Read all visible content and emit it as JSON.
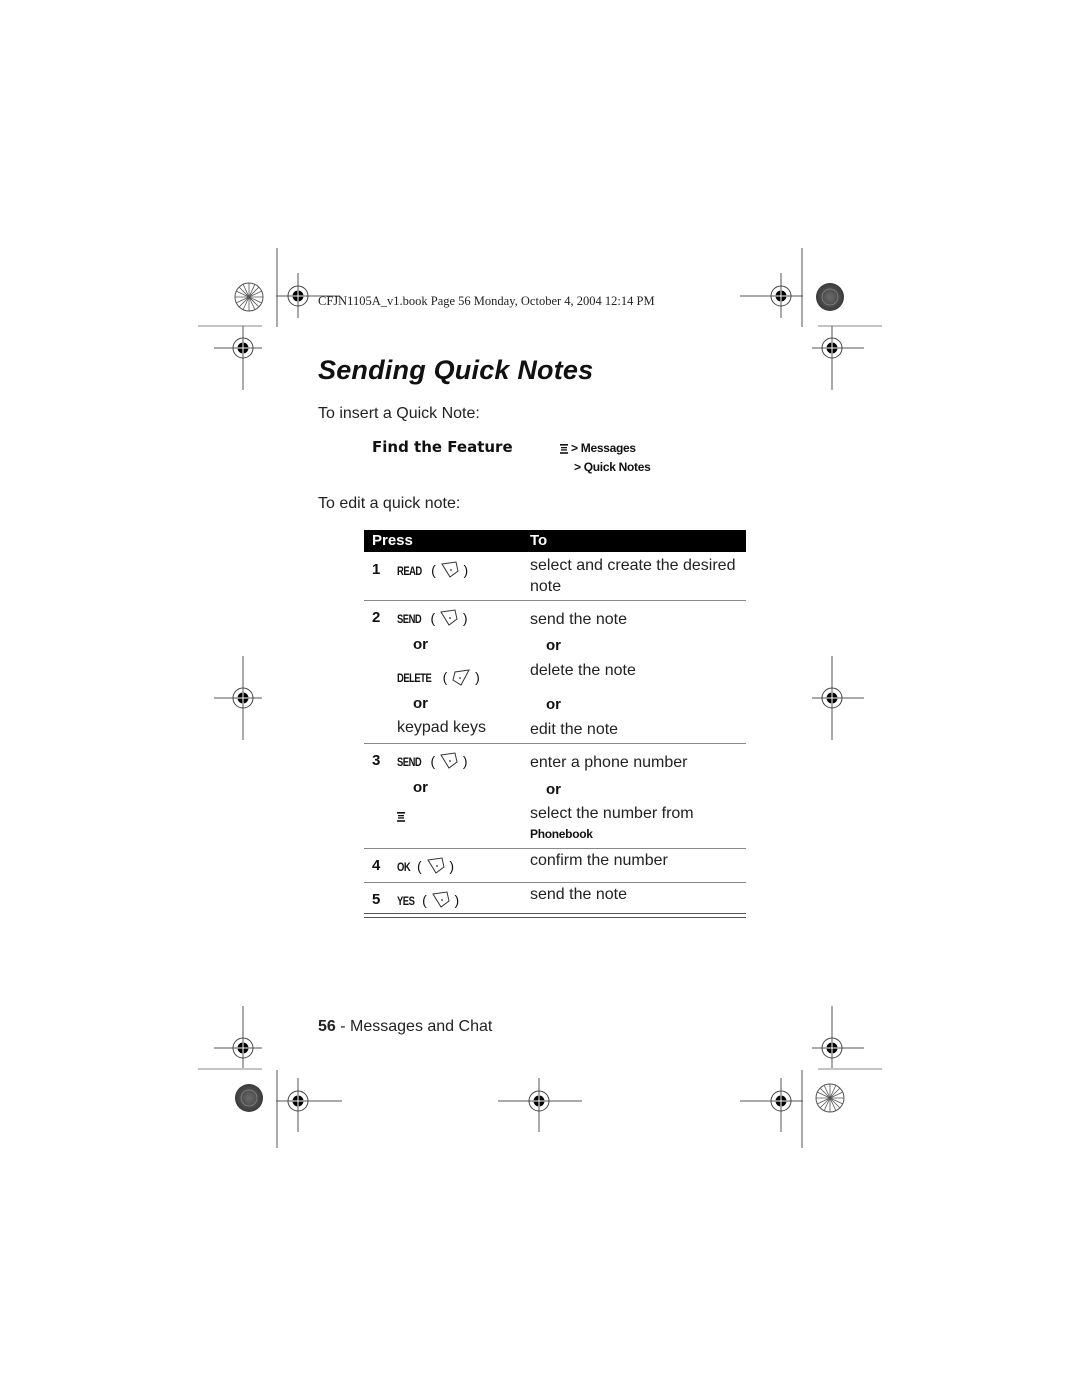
{
  "header": {
    "print_line": "CFJN1105A_v1.book  Page 56  Monday, October 4, 2004  12:14 PM"
  },
  "title": "Sending Quick Notes",
  "intro_insert": "To insert a Quick Note:",
  "find_feature": {
    "label": "Find the Feature",
    "menu_icon": "menu-icon",
    "path": [
      "> Messages",
      "> Quick Notes"
    ]
  },
  "intro_edit": "To edit a quick note:",
  "table": {
    "headers": {
      "press": "Press",
      "to": "To"
    },
    "or_label": "or",
    "rows": [
      {
        "step": "1",
        "items": [
          {
            "key": "READ",
            "icon": "right-soft-key-icon",
            "to": "select and create the desired note"
          }
        ]
      },
      {
        "step": "2",
        "items": [
          {
            "key": "SEND",
            "icon": "right-soft-key-icon",
            "to": "send the note"
          },
          {
            "key": "DELETE",
            "icon": "left-soft-key-icon",
            "to": "delete the note"
          },
          {
            "key": "keypad keys",
            "icon": "",
            "to": "edit the note"
          }
        ]
      },
      {
        "step": "3",
        "items": [
          {
            "key": "SEND",
            "icon": "right-soft-key-icon",
            "to": "enter a phone number"
          },
          {
            "key": "",
            "icon": "menu-icon",
            "to": "select the number from",
            "to_bold": "Phonebook"
          }
        ]
      },
      {
        "step": "4",
        "items": [
          {
            "key": "OK",
            "icon": "right-soft-key-icon",
            "to": "confirm the number"
          }
        ]
      },
      {
        "step": "5",
        "items": [
          {
            "key": "YES",
            "icon": "right-soft-key-icon",
            "to": "send the note"
          }
        ]
      }
    ]
  },
  "footer": {
    "page_number": "56",
    "section": " - Messages and Chat"
  }
}
